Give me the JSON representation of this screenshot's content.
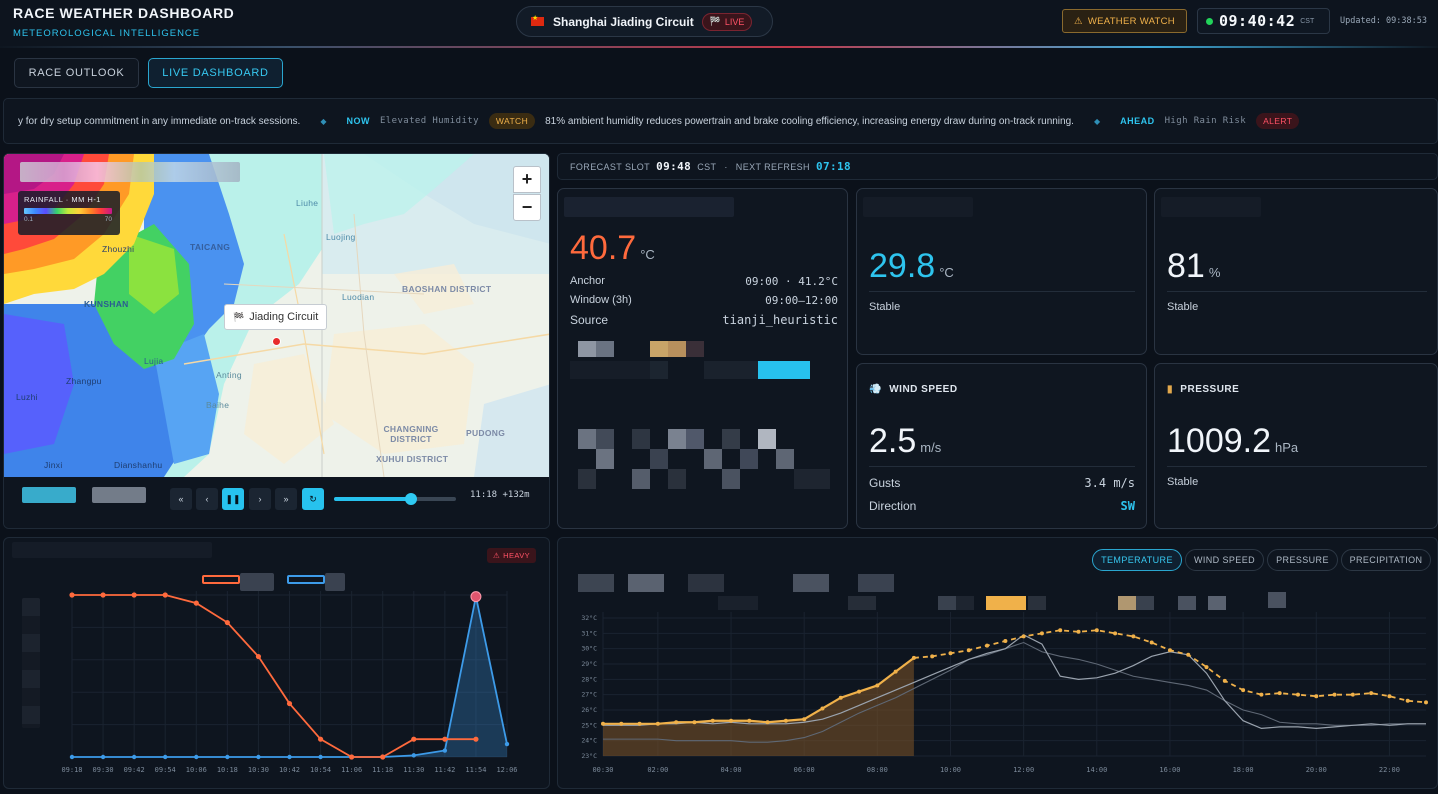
{
  "header": {
    "title": "RACE WEATHER DASHBOARD",
    "subtitle": "METEOROLOGICAL INTELLIGENCE",
    "circuit_name": "Shanghai Jiading Circuit",
    "live_label": "LIVE",
    "watch_label": "WEATHER WATCH",
    "clock_time": "09:40:42",
    "clock_tz": "CST",
    "updated_text": "Updated: 09:38:53"
  },
  "tabs": [
    {
      "label": "RACE OUTLOOK",
      "active": false
    },
    {
      "label": "LIVE DASHBOARD",
      "active": true
    }
  ],
  "ticker": {
    "lead_text": "y for dry setup commitment in any immediate on-track sessions.",
    "now_label": "NOW",
    "now_tag": "Elevated Humidity",
    "now_badge": "WATCH",
    "now_text": "81% ambient humidity reduces powertrain and brake cooling efficiency, increasing energy draw during on-track running.",
    "ahead_label": "AHEAD",
    "ahead_tag": "High Rain Risk",
    "ahead_badge": "ALERT"
  },
  "map": {
    "legend_title": "RAINFALL · MM H-1",
    "legend_min": "0.1",
    "legend_max": "70",
    "zoom_in": "+",
    "zoom_out": "−",
    "circuit_label": "Jiading Circuit",
    "labels": [
      {
        "name": "TAICANG",
        "kind": "district"
      },
      {
        "name": "KUNSHAN",
        "kind": "district"
      },
      {
        "name": "BAOSHAN DISTRICT",
        "kind": "district"
      },
      {
        "name": "CHANGNING DISTRICT",
        "kind": "district"
      },
      {
        "name": "XUHUI DISTRICT",
        "kind": "district"
      },
      {
        "name": "PUDONG",
        "kind": "district"
      },
      {
        "name": "Liuhe",
        "kind": "town"
      },
      {
        "name": "Luojing",
        "kind": "town"
      },
      {
        "name": "Luodian",
        "kind": "town"
      },
      {
        "name": "Zhouzhi",
        "kind": "town"
      },
      {
        "name": "Lujia",
        "kind": "town"
      },
      {
        "name": "Anting",
        "kind": "town"
      },
      {
        "name": "Zhangpu",
        "kind": "town"
      },
      {
        "name": "Luzhi",
        "kind": "town"
      },
      {
        "name": "Baihe",
        "kind": "town"
      },
      {
        "name": "Jinxi",
        "kind": "town"
      },
      {
        "name": "Dianshanhu",
        "kind": "town"
      }
    ],
    "playback": {
      "controls": [
        "«",
        "‹",
        "❚❚",
        "›",
        "»",
        "↻"
      ],
      "progress": 0.63,
      "time_label": "11:18 +132m"
    }
  },
  "forecast_slot": {
    "label": "FORECAST SLOT",
    "time": "09:48",
    "tz": "CST",
    "separator": "·",
    "refresh_label": "NEXT REFRESH",
    "refresh_value": "07:18"
  },
  "temp_card": {
    "value": "40.7",
    "unit": "°C",
    "rows": [
      {
        "label": "Anchor",
        "value": "09:00 · 41.2°C"
      },
      {
        "label": "Window (3h)",
        "value": "09:00–12:00"
      },
      {
        "label": "Source",
        "value": "tianji_heuristic"
      }
    ]
  },
  "track_temp": {
    "value": "29.8",
    "unit": "°C",
    "status": "Stable"
  },
  "humidity": {
    "value": "81",
    "unit": "%",
    "status": "Stable"
  },
  "wind": {
    "title": "WIND SPEED",
    "value": "2.5",
    "unit": "m/s",
    "gusts_label": "Gusts",
    "gusts_value": "3.4 m/s",
    "direction_label": "Direction",
    "direction_value": "SW"
  },
  "pressure": {
    "title": "PRESSURE",
    "value": "1009.2",
    "unit": "hPa",
    "status": "Stable"
  },
  "colors": {
    "accent": "#2ec4ee",
    "hot": "#ff6a3d",
    "warning": "#f0b14a",
    "alert": "#ff5266",
    "rain_series": "#3d9be9",
    "temp_series": "#ff6a3d"
  },
  "rain_chart": {
    "badge": "HEAVY"
  },
  "metric_buttons": [
    {
      "label": "TEMPERATURE",
      "active": true
    },
    {
      "label": "WIND SPEED",
      "active": false
    },
    {
      "label": "PRESSURE",
      "active": false
    },
    {
      "label": "PRECIPITATION",
      "active": false
    }
  ],
  "icons": {
    "warning": "warning-icon",
    "wind": "wind-icon",
    "pressure": "barometer-icon"
  },
  "chart_data": [
    {
      "type": "line",
      "title": "",
      "x": [
        "09:18",
        "09:30",
        "09:42",
        "09:54",
        "10:06",
        "10:18",
        "10:30",
        "10:42",
        "10:54",
        "11:06",
        "11:18",
        "11:30",
        "11:42",
        "11:54",
        "12:06"
      ],
      "series": [
        {
          "values": [
            100,
            100,
            100,
            100,
            95,
            83,
            62,
            33,
            11,
            0,
            0,
            11,
            11,
            11,
            null
          ]
        },
        {
          "values": [
            0,
            0,
            0,
            0,
            0,
            0,
            0,
            0,
            0,
            0,
            0,
            1,
            4,
            99,
            8
          ]
        }
      ],
      "ylim": [
        0,
        100
      ],
      "grid": true
    },
    {
      "type": "line",
      "title": "",
      "x": [
        "00:30",
        "01:00",
        "01:30",
        "02:00",
        "02:30",
        "03:00",
        "03:30",
        "04:00",
        "04:30",
        "05:00",
        "05:30",
        "06:00",
        "06:30",
        "07:00",
        "07:30",
        "08:00",
        "08:30",
        "09:00",
        "09:30",
        "10:00",
        "10:30",
        "11:00",
        "11:30",
        "12:00",
        "12:30",
        "13:00",
        "13:30",
        "14:00",
        "14:30",
        "15:00",
        "15:30",
        "16:00",
        "16:30",
        "17:00",
        "17:30",
        "18:00",
        "18:30",
        "19:00",
        "19:30",
        "20:00",
        "20:30",
        "21:00",
        "21:30",
        "22:00",
        "22:30",
        "23:00"
      ],
      "x_ticks": [
        "00:30",
        "02:00",
        "04:00",
        "06:00",
        "08:00",
        "10:00",
        "12:00",
        "14:00",
        "16:00",
        "18:00",
        "20:00",
        "22:00"
      ],
      "y_ticks": [
        "23°C",
        "24°C",
        "25°C",
        "26°C",
        "27°C",
        "28°C",
        "29°C",
        "30°C",
        "31°C",
        "32°C"
      ],
      "series": [
        {
          "values": [
            25.1,
            25.1,
            25.1,
            25.1,
            25.2,
            25.2,
            25.3,
            25.3,
            25.3,
            25.2,
            25.3,
            25.4,
            26.1,
            26.8,
            27.2,
            27.6,
            28.5,
            29.4,
            29.5,
            29.7,
            29.9,
            30.2,
            30.5,
            30.8,
            31.0,
            31.2,
            31.1,
            31.2,
            31.0,
            30.8,
            30.4,
            29.9,
            29.6,
            28.8,
            27.9,
            27.3,
            27.0,
            27.1,
            27.0,
            26.9,
            27.0,
            27.0,
            27.1,
            26.9,
            26.6,
            26.5
          ]
        },
        {
          "values": [
            25.0,
            25.0,
            25.0,
            25.1,
            25.1,
            25.2,
            25.1,
            25.2,
            25.1,
            25.1,
            25.1,
            25.2,
            25.4,
            25.8,
            26.3,
            26.8,
            27.3,
            27.8,
            28.3,
            28.8,
            29.3,
            29.7,
            30.0,
            30.9,
            30.3,
            28.2,
            28.0,
            28.1,
            28.4,
            28.9,
            29.5,
            29.8,
            29.6,
            28.4,
            26.6,
            25.3,
            24.8,
            24.9,
            24.9,
            24.8,
            24.9,
            25.0,
            25.1,
            25.0,
            25.1,
            25.1
          ]
        },
        {
          "values": [
            24.1,
            24.1,
            24.1,
            24.1,
            24.0,
            24.0,
            24.0,
            24.0,
            23.9,
            23.9,
            24.0,
            24.2,
            24.6,
            25.2,
            25.8,
            26.3,
            26.8,
            27.4,
            28.0,
            28.6,
            29.3,
            29.6,
            30.0,
            30.4,
            29.8,
            29.5,
            29.3,
            29.0,
            28.6,
            28.2,
            28.0,
            27.8,
            27.6,
            27.3,
            26.6,
            26.0,
            25.7,
            25.2,
            25.1,
            25.1,
            25.0,
            25.0,
            25.0,
            25.1,
            25.1,
            25.1
          ]
        }
      ],
      "ylim": [
        23,
        32
      ],
      "grid": true
    }
  ]
}
